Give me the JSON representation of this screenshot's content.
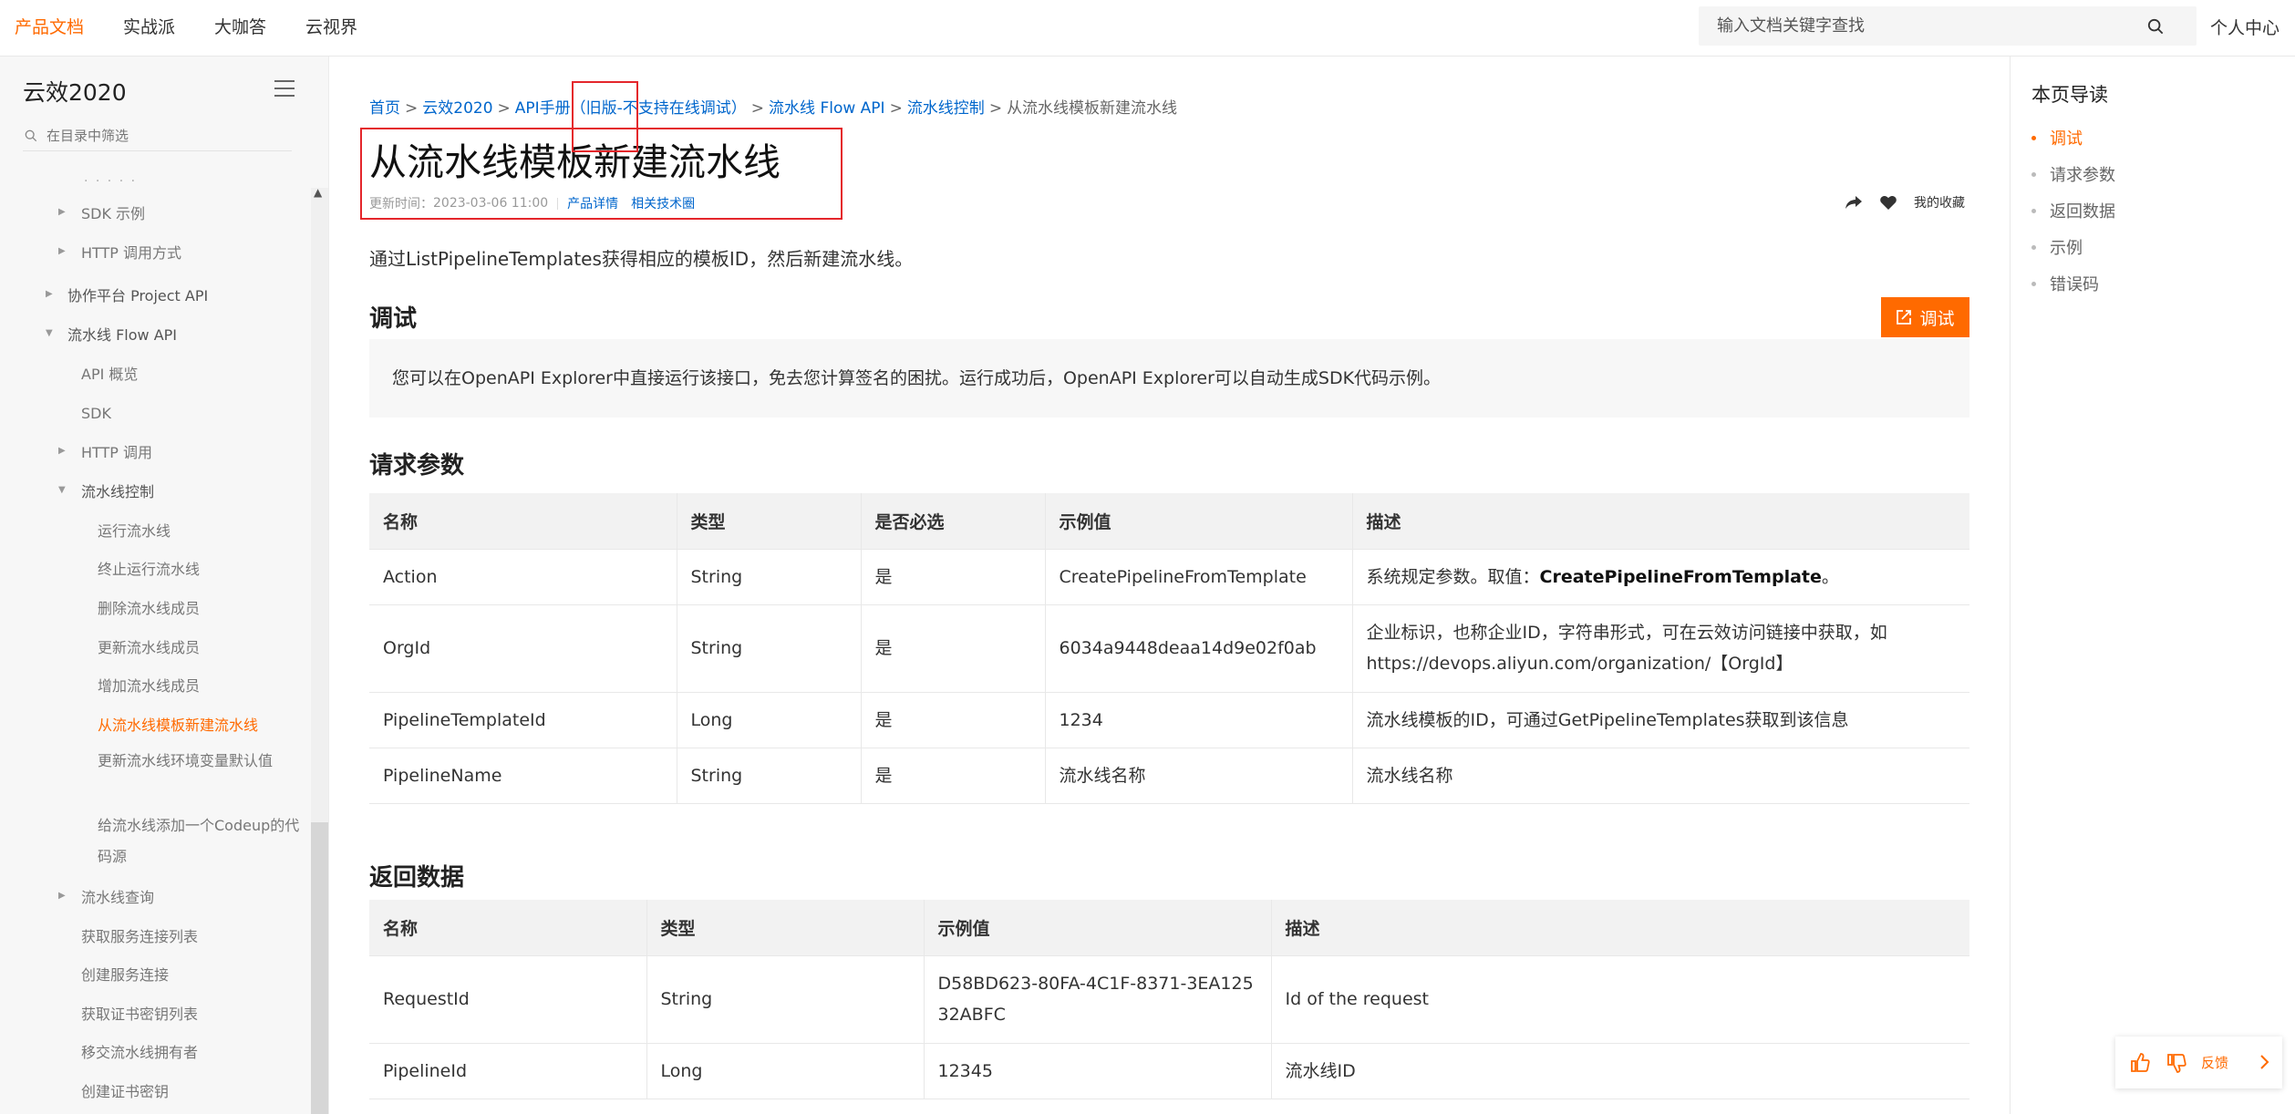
{
  "topnav": {
    "items": [
      "产品文档",
      "实战派",
      "大咖答",
      "云视界"
    ],
    "active_index": 0,
    "search_placeholder": "输入文档关键字查找",
    "user_center": "个人中心"
  },
  "sidebar": {
    "title": "云效2020",
    "filter_placeholder": "在目录中筛选",
    "items": [
      {
        "label": "SDK 示例"
      },
      {
        "label": "HTTP 调用方式"
      },
      {
        "label": "协作平台 Project API"
      },
      {
        "label": "流水线 Flow API"
      },
      {
        "label": "API 概览"
      },
      {
        "label": "SDK"
      },
      {
        "label": "HTTP 调用"
      },
      {
        "label": "流水线控制"
      },
      {
        "label": "运行流水线"
      },
      {
        "label": "终止运行流水线"
      },
      {
        "label": "删除流水线成员"
      },
      {
        "label": "更新流水线成员"
      },
      {
        "label": "增加流水线成员"
      },
      {
        "label": "从流水线模板新建流水线"
      },
      {
        "label": "更新流水线环境变量默认值"
      },
      {
        "label": "给流水线添加一个Codeup的代码源"
      },
      {
        "label": "流水线查询"
      },
      {
        "label": "获取服务连接列表"
      },
      {
        "label": "创建服务连接"
      },
      {
        "label": "获取证书密钥列表"
      },
      {
        "label": "移交流水线拥有者"
      },
      {
        "label": "创建证书密钥"
      }
    ],
    "active_item": "从流水线模板新建流水线"
  },
  "breadcrumb": {
    "home": "首页",
    "product": "云效2020",
    "manual": "API手册（旧版-不支持在线调试）",
    "flow_api": "流水线 Flow API",
    "control": "流水线控制",
    "current": "从流水线模板新建流水线",
    "separator": ">"
  },
  "page": {
    "title": "从流水线模板新建流水线",
    "updated_label": "更新时间：",
    "updated_time": "2023-03-06 11:00",
    "product_detail": "产品详情",
    "related_tech": "相关技术圈",
    "favorite": "我的收藏",
    "intro": "通过ListPipelineTemplates获得相应的模板ID，然后新建流水线。"
  },
  "debug": {
    "heading": "调试",
    "button": "调试",
    "tip": "您可以在OpenAPI Explorer中直接运行该接口，免去您计算签名的困扰。运行成功后，OpenAPI Explorer可以自动生成SDK代码示例。"
  },
  "request_params": {
    "heading": "请求参数",
    "columns": [
      "名称",
      "类型",
      "是否必选",
      "示例值",
      "描述"
    ],
    "rows": [
      {
        "name": "Action",
        "type": "String",
        "required": "是",
        "example": "CreatePipelineFromTemplate",
        "desc": "系统规定参数。取值：",
        "desc_bold": "CreatePipelineFromTemplate",
        "desc_tail": "。"
      },
      {
        "name": "OrgId",
        "type": "String",
        "required": "是",
        "example": "6034a9448deaa14d9e02f0ab",
        "desc": "企业标识，也称企业ID，字符串形式，可在云效访问链接中获取，如https://devops.aliyun.com/organization/【OrgId】"
      },
      {
        "name": "PipelineTemplateId",
        "type": "Long",
        "required": "是",
        "example": "1234",
        "desc": "流水线模板的ID，可通过GetPipelineTemplates获取到该信息"
      },
      {
        "name": "PipelineName",
        "type": "String",
        "required": "是",
        "example": "流水线名称",
        "desc": "流水线名称"
      }
    ]
  },
  "response_data": {
    "heading": "返回数据",
    "columns": [
      "名称",
      "类型",
      "示例值",
      "描述"
    ],
    "rows": [
      {
        "name": "RequestId",
        "type": "String",
        "example": "D58BD623-80FA-4C1F-8371-3EA12532ABFC",
        "desc": "Id of the request"
      },
      {
        "name": "PipelineId",
        "type": "Long",
        "example": "12345",
        "desc": "流水线ID"
      }
    ]
  },
  "toc": {
    "title": "本页导读",
    "items": [
      "调试",
      "请求参数",
      "返回数据",
      "示例",
      "错误码"
    ],
    "active_index": 0
  },
  "feedback": {
    "label": "反馈"
  },
  "colors": {
    "accent": "#ff6a00",
    "link": "#0066cc",
    "highlight": "#e4262b"
  }
}
